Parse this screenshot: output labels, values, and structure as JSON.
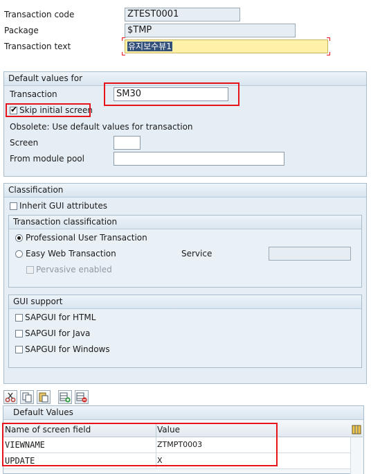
{
  "header": {
    "transaction_code_label": "Transaction code",
    "transaction_code_value": "ZTEST0001",
    "package_label": "Package",
    "package_value": "$TMP",
    "transaction_text_label": "Transaction text",
    "transaction_text_value": "유지보수뷰1"
  },
  "default_values": {
    "title": "Default values for",
    "transaction_label": "Transaction",
    "transaction_value": "SM30",
    "skip_initial_screen_label": "Skip initial screen",
    "skip_initial_screen_checked": true,
    "obsolete_text": "Obsolete: Use default values for transaction",
    "screen_label": "Screen",
    "screen_value": "",
    "module_pool_label": "From module pool",
    "module_pool_value": ""
  },
  "classification": {
    "title": "Classification",
    "inherit_gui_label": "Inherit GUI attributes",
    "transaction_classification": {
      "title": "Transaction classification",
      "professional_label": "Professional User Transaction",
      "professional_selected": true,
      "easy_web_label": "Easy Web Transaction",
      "service_label": "Service",
      "service_value": "",
      "pervasive_label": "Pervasive enabled"
    },
    "gui_support": {
      "title": "GUI support",
      "html_label": "SAPGUI for HTML",
      "java_label": "SAPGUI for Java",
      "windows_label": "SAPGUI for Windows"
    }
  },
  "toolbar": {
    "icons": [
      "cut-icon",
      "copy-icon",
      "paste-icon",
      "insert-row-icon",
      "delete-row-icon"
    ]
  },
  "default_values_table": {
    "title": "Default Values",
    "columns": [
      "Name of screen field",
      "Value"
    ],
    "rows": [
      {
        "name": "VIEWNAME",
        "value": "ZTMPT0003"
      },
      {
        "name": "UPDATE",
        "value": "X"
      }
    ]
  },
  "colors": {
    "highlight_red": "#e8121a",
    "group_bg": "#e6eef5",
    "required_field": "#fff2a8"
  }
}
